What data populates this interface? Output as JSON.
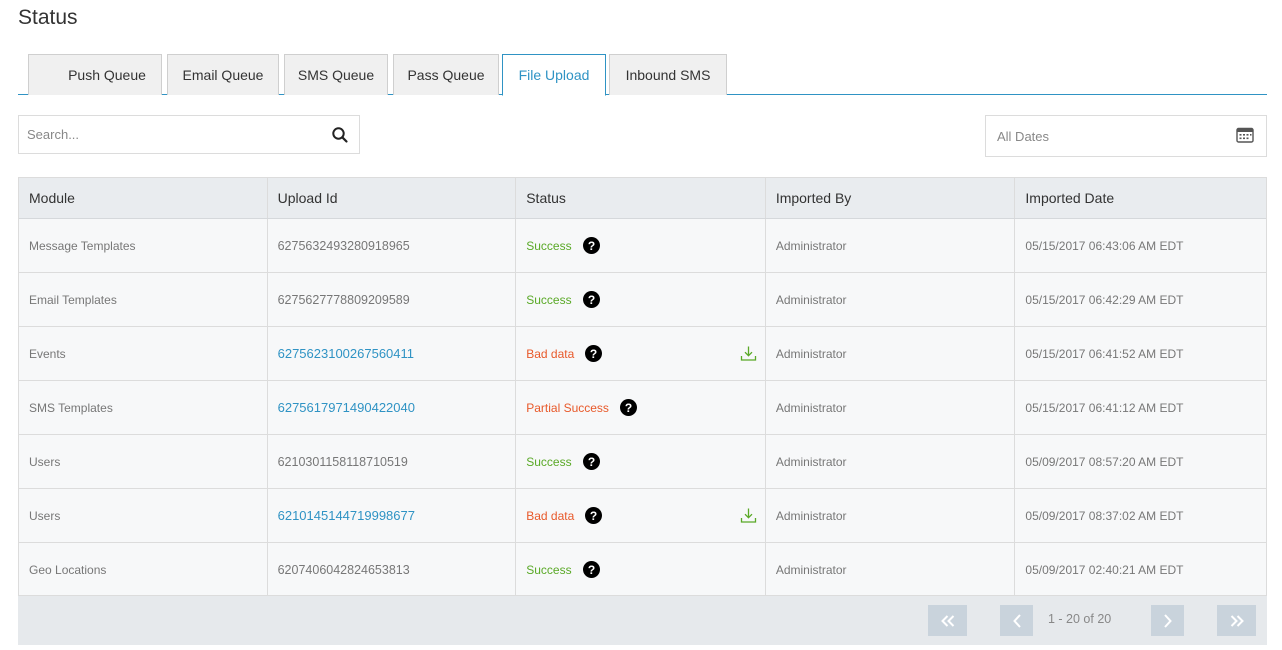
{
  "page": {
    "title": "Status"
  },
  "tabs": [
    {
      "label": "Push Queue",
      "active": false
    },
    {
      "label": "Email Queue",
      "active": false
    },
    {
      "label": "SMS Queue",
      "active": false
    },
    {
      "label": "Pass Queue",
      "active": false
    },
    {
      "label": "File Upload",
      "active": true
    },
    {
      "label": "Inbound SMS",
      "active": false
    }
  ],
  "search": {
    "placeholder": "Search...",
    "icon": "search-icon"
  },
  "date_filter": {
    "placeholder": "All Dates",
    "icon": "calendar-icon"
  },
  "table": {
    "columns": [
      "Module",
      "Upload Id",
      "Status",
      "Imported By",
      "Imported Date"
    ],
    "rows": [
      {
        "module": "Message Templates",
        "upload_id": "6275632493280918965",
        "status": "Success",
        "imported_by": "Administrator",
        "imported_date": "05/15/2017 06:43:06 AM EDT"
      },
      {
        "module": "Email Templates",
        "upload_id": "6275627778809209589",
        "status": "Success",
        "imported_by": "Administrator",
        "imported_date": "05/15/2017 06:42:29 AM EDT"
      },
      {
        "module": "Events",
        "upload_id": "6275623100267560411",
        "status": "Bad data",
        "imported_by": "Administrator",
        "imported_date": "05/15/2017 06:41:52 AM EDT"
      },
      {
        "module": "SMS Templates",
        "upload_id": "6275617971490422040",
        "status": "Partial Success",
        "imported_by": "Administrator",
        "imported_date": "05/15/2017 06:41:12 AM EDT"
      },
      {
        "module": "Users",
        "upload_id": "6210301158118710519",
        "status": "Success",
        "imported_by": "Administrator",
        "imported_date": "05/09/2017 08:57:20 AM EDT"
      },
      {
        "module": "Users",
        "upload_id": "6210145144719998677",
        "status": "Bad data",
        "imported_by": "Administrator",
        "imported_date": "05/09/2017 08:37:02 AM EDT"
      },
      {
        "module": "Geo Locations",
        "upload_id": "6207406042824653813",
        "status": "Success",
        "imported_by": "Administrator",
        "imported_date": "05/09/2017 02:40:21 AM EDT"
      }
    ]
  },
  "pagination": {
    "info": "1 - 20 of 20"
  },
  "colors": {
    "accent": "#2f93c4",
    "success": "#5aa927",
    "error": "#e8592a",
    "download": "#5aa927"
  }
}
